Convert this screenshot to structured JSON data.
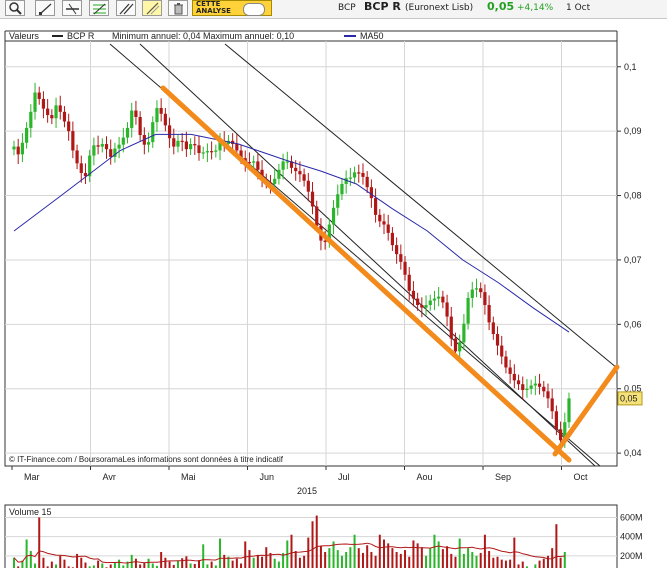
{
  "header": {
    "ticker": "BCP",
    "name": "BCP R",
    "exchange": "(Euronext Lisb)",
    "price": "0,05",
    "change": "+4,14%",
    "date": "1 Oct"
  },
  "toolbar": {
    "analysis_label": "CETTE ANALYSE"
  },
  "legend": {
    "values_label": "Valeurs",
    "series_name": "BCP R",
    "annual_range": "Minimum annuel: 0,04 Maximum annuel: 0,10",
    "ma_name": "MA50"
  },
  "copyright": "© IT-Finance.com / BoursoramaLes informations sont données à titre indicatif",
  "colors": {
    "up": "#2bb52b",
    "down": "#b01818",
    "ma": "#2a2aa8",
    "trendline": "#f28a1c",
    "channel": "#222222",
    "price_tag": "#f6e27a"
  },
  "chart_data": {
    "type": "candlestick",
    "ylim": [
      0.038,
      0.104
    ],
    "yticks": [
      {
        "v": 0.1,
        "label": "0,1"
      },
      {
        "v": 0.09,
        "label": "0,09"
      },
      {
        "v": 0.08,
        "label": "0,08"
      },
      {
        "v": 0.07,
        "label": "0,07"
      },
      {
        "v": 0.06,
        "label": "0,06"
      },
      {
        "v": 0.05,
        "label": "0,05"
      },
      {
        "v": 0.04,
        "label": "0,04"
      }
    ],
    "months": [
      "Mar",
      "Avr",
      "Mai",
      "Jun",
      "Jul",
      "Aou",
      "Sep",
      "Oct"
    ],
    "year": "2015",
    "last_price_label": "0,05",
    "last_price": 0.0485,
    "closes": [
      0.0876,
      0.0864,
      0.0882,
      0.0905,
      0.093,
      0.096,
      0.095,
      0.0935,
      0.0925,
      0.092,
      0.094,
      0.093,
      0.0915,
      0.09,
      0.087,
      0.085,
      0.0835,
      0.083,
      0.0862,
      0.0878,
      0.0876,
      0.088,
      0.0872,
      0.086,
      0.0873,
      0.0879,
      0.089,
      0.0905,
      0.0932,
      0.0922,
      0.0894,
      0.0879,
      0.0883,
      0.0914,
      0.0936,
      0.0927,
      0.0909,
      0.0889,
      0.0876,
      0.0885,
      0.0884,
      0.0872,
      0.088,
      0.0878,
      0.0866,
      0.0867,
      0.0869,
      0.0868,
      0.087,
      0.0885,
      0.088,
      0.0885,
      0.088,
      0.087,
      0.0858,
      0.0852,
      0.0851,
      0.0853,
      0.084,
      0.0825,
      0.082,
      0.0818,
      0.0826,
      0.084,
      0.0853,
      0.0853,
      0.0843,
      0.0838,
      0.0833,
      0.0823,
      0.0806,
      0.0783,
      0.0753,
      0.073,
      0.0728,
      0.0755,
      0.0781,
      0.0802,
      0.0818,
      0.0827,
      0.0828,
      0.0836,
      0.0835,
      0.0829,
      0.0813,
      0.0796,
      0.077,
      0.076,
      0.0755,
      0.0742,
      0.0723,
      0.0709,
      0.0697,
      0.0677,
      0.0652,
      0.064,
      0.063,
      0.0626,
      0.063,
      0.0637,
      0.064,
      0.0643,
      0.0634,
      0.0612,
      0.0578,
      0.0558,
      0.0572,
      0.0601,
      0.0641,
      0.0654,
      0.0656,
      0.065,
      0.063,
      0.0603,
      0.0585,
      0.0567,
      0.055,
      0.0533,
      0.0523,
      0.0513,
      0.0507,
      0.0498,
      0.05,
      0.0505,
      0.0508,
      0.0503,
      0.0496,
      0.0485,
      0.0465,
      0.0437,
      0.042,
      0.0448,
      0.0485
    ],
    "ma50": [
      [
        0,
        0.0745
      ],
      [
        20,
        0.08
      ],
      [
        45,
        0.087
      ],
      [
        60,
        0.0895
      ],
      [
        75,
        0.0895
      ],
      [
        95,
        0.088
      ],
      [
        115,
        0.0855
      ],
      [
        130,
        0.0838
      ],
      [
        145,
        0.0818
      ],
      [
        160,
        0.078
      ],
      [
        175,
        0.0745
      ],
      [
        190,
        0.07
      ],
      [
        205,
        0.0665
      ],
      [
        220,
        0.0625
      ],
      [
        235,
        0.0588
      ]
    ],
    "ma50_x_total": 235,
    "volume": {
      "title": "Volume 15",
      "yticks": [
        {
          "v": 600,
          "label": "600M"
        },
        {
          "v": 400,
          "label": "400M"
        },
        {
          "v": 200,
          "label": "200M"
        }
      ],
      "ylim": [
        0,
        730
      ],
      "bars": [
        180,
        90,
        150,
        370,
        250,
        120,
        600,
        180,
        90,
        140,
        110,
        200,
        160,
        90,
        80,
        220,
        180,
        130,
        90,
        100,
        150,
        120,
        80,
        110,
        130,
        160,
        100,
        140,
        210,
        170,
        110,
        130,
        170,
        120,
        95,
        240,
        180,
        140,
        105,
        150,
        175,
        195,
        120,
        115,
        155,
        320,
        110,
        140,
        100,
        380,
        210,
        190,
        150,
        170,
        120,
        350,
        260,
        180,
        210,
        190,
        290,
        230,
        170,
        140,
        230,
        360,
        420,
        250,
        180,
        200,
        390,
        560,
        620,
        300,
        240,
        280,
        350,
        260,
        200,
        240,
        290,
        420,
        280,
        230,
        310,
        240,
        200,
        420,
        370,
        330,
        280,
        240,
        220,
        260,
        190,
        360,
        330,
        290,
        200,
        280,
        420,
        350,
        270,
        300,
        220,
        190,
        380,
        220,
        280,
        240,
        200,
        230,
        420,
        250,
        180,
        190,
        160,
        150,
        160,
        390,
        110,
        140,
        90,
        70,
        110,
        150,
        170,
        200,
        280,
        530,
        180,
        240
      ]
    }
  }
}
